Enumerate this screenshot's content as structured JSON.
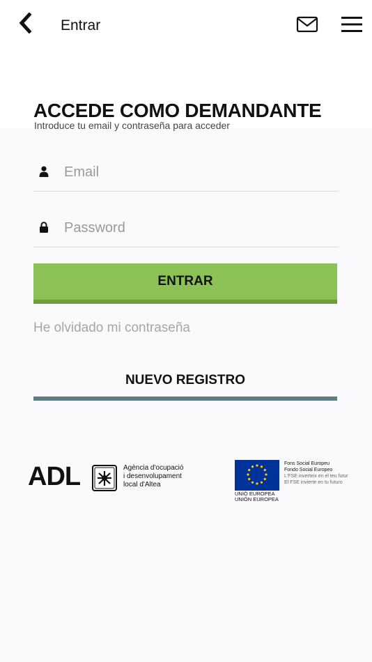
{
  "header": {
    "title": "Entrar"
  },
  "login": {
    "heading": "ACCEDE COMO DEMANDANTE",
    "subtitle": "Introduce tu email y contraseña para acceder",
    "email_placeholder": "Email",
    "password_placeholder": "Password",
    "submit_label": "ENTRAR",
    "forgot_label": "He olvidado mi contraseña",
    "register_label": "NUEVO REGISTRO"
  },
  "logos": {
    "adl": {
      "mark": "ADL",
      "caption_line1": "Agència d'ocupació",
      "caption_line2": "i desenvolupament",
      "caption_line3": "local d'Altea"
    },
    "eu": {
      "flag_caption_line1": "UNIÓ EUROPEA",
      "flag_caption_line2": "UNIÓN EUROPEA",
      "line1": "Fons Social Europeu",
      "line2": "Fondo Social Europeo",
      "line3": "L'FSE inverteix en el teu futur",
      "line4": "El FSE invierte en tu futuro"
    }
  },
  "colors": {
    "accent_green": "#8bc155",
    "accent_green_dark": "#6f9c3c",
    "register_bar": "#5e7f86",
    "eu_blue": "#003399",
    "eu_star": "#ffcc00"
  },
  "icons": {
    "back": "chevron-left-icon",
    "mail": "envelope-icon",
    "menu": "hamburger-menu-icon",
    "user": "user-icon",
    "lock": "lock-icon"
  }
}
